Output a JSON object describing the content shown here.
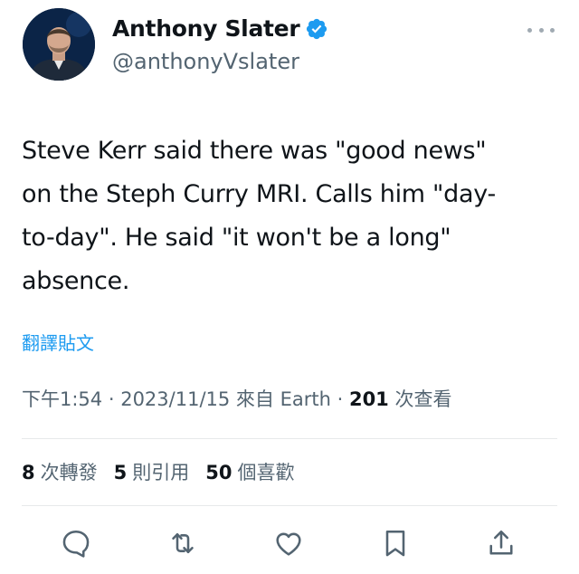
{
  "author": {
    "display_name": "Anthony Slater",
    "handle": "@anthonyVslater",
    "verified_icon": "verified-badge-icon",
    "avatar_icon": "avatar"
  },
  "tweet": {
    "text": "Steve Kerr said there was \"good news\"\non the Steph Curry MRI. Calls him \"day-\nto-day\". He said \"it won't be a long\"\nabsence."
  },
  "translate_label": "翻譯貼文",
  "meta": {
    "time": "下午1:54",
    "sep1": " · ",
    "date": "2023/11/15",
    "source": " 來自 Earth",
    "sep2": " · ",
    "views_count": "201",
    "views_label": " 次查看"
  },
  "stats": {
    "reposts_count": "8",
    "reposts_label": "次轉發",
    "quotes_count": "5",
    "quotes_label": "則引用",
    "likes_count": "50",
    "likes_label": "個喜歡"
  },
  "actions": [
    "reply-icon",
    "retweet-icon",
    "like-icon",
    "bookmark-icon",
    "share-icon"
  ],
  "colors": {
    "accent": "#1d9bf0",
    "secondary_text": "#536471",
    "primary_text": "#0f1419",
    "divider": "#e7e9ea"
  }
}
